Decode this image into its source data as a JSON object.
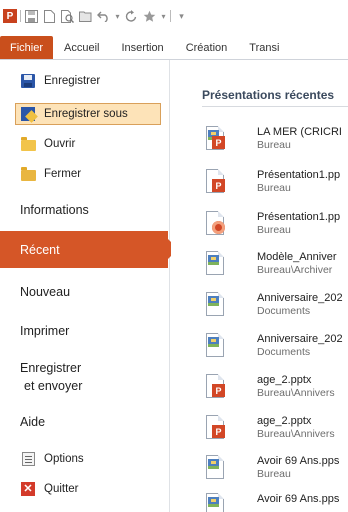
{
  "quick_access": {
    "logo_text": "P",
    "icons": [
      "powerpoint-logo-icon",
      "save-icon",
      "new-document-icon",
      "print-preview-icon",
      "open-folder-icon",
      "undo-icon",
      "redo-icon",
      "star-icon",
      "customize-toolbar-icon"
    ]
  },
  "ribbon": {
    "tabs": [
      {
        "label": "Fichier",
        "active": true
      },
      {
        "label": "Accueil"
      },
      {
        "label": "Insertion"
      },
      {
        "label": "Création"
      },
      {
        "label": "Transi"
      }
    ]
  },
  "nav": {
    "items": [
      {
        "label": "Enregistrer",
        "icon": "save-icon"
      },
      {
        "label": "Enregistrer sous",
        "icon": "save-as-icon",
        "highlighted": true
      },
      {
        "label": "Ouvrir",
        "icon": "open-folder-icon"
      },
      {
        "label": "Fermer",
        "icon": "close-folder-icon"
      },
      {
        "label": "Informations"
      },
      {
        "label": "Récent",
        "active": true
      },
      {
        "label": "Nouveau"
      },
      {
        "label": "Imprimer"
      },
      {
        "label": "Enregistrer",
        "label2": "et envoyer"
      },
      {
        "label": "Aide"
      },
      {
        "label": "Options",
        "icon": "options-icon"
      },
      {
        "label": "Quitter",
        "icon": "exit-icon"
      }
    ]
  },
  "recent": {
    "title": "Présentations récentes",
    "files": [
      {
        "name": "LA MER (CRICRI",
        "path": "Bureau",
        "icon": "template-ppt-icon"
      },
      {
        "name": "Présentation1.pp",
        "path": "Bureau",
        "icon": "pptx-icon"
      },
      {
        "name": "Présentation1.pp",
        "path": "Bureau",
        "icon": "ppsx-icon"
      },
      {
        "name": "Modèle_Anniver",
        "path": "Bureau\\Archiver",
        "icon": "template-icon"
      },
      {
        "name": "Anniversaire_202",
        "path": "Documents",
        "icon": "template-icon"
      },
      {
        "name": "Anniversaire_202",
        "path": "Documents",
        "icon": "template-icon"
      },
      {
        "name": "age_2.pptx",
        "path": "Bureau\\Annivers",
        "icon": "pptx-icon"
      },
      {
        "name": "age_2.pptx",
        "path": "Bureau\\Annivers",
        "icon": "pptx-icon"
      },
      {
        "name": "Avoir 69 Ans.pps",
        "path": "Bureau",
        "icon": "template-icon"
      },
      {
        "name": "Avoir 69 Ans.pps",
        "path": "",
        "icon": "template-icon"
      }
    ]
  },
  "colors": {
    "file_tab": "#c94f1c",
    "active_nav": "#d55627",
    "highlight_bg": "#fde3b8",
    "highlight_border": "#d9a05a"
  }
}
